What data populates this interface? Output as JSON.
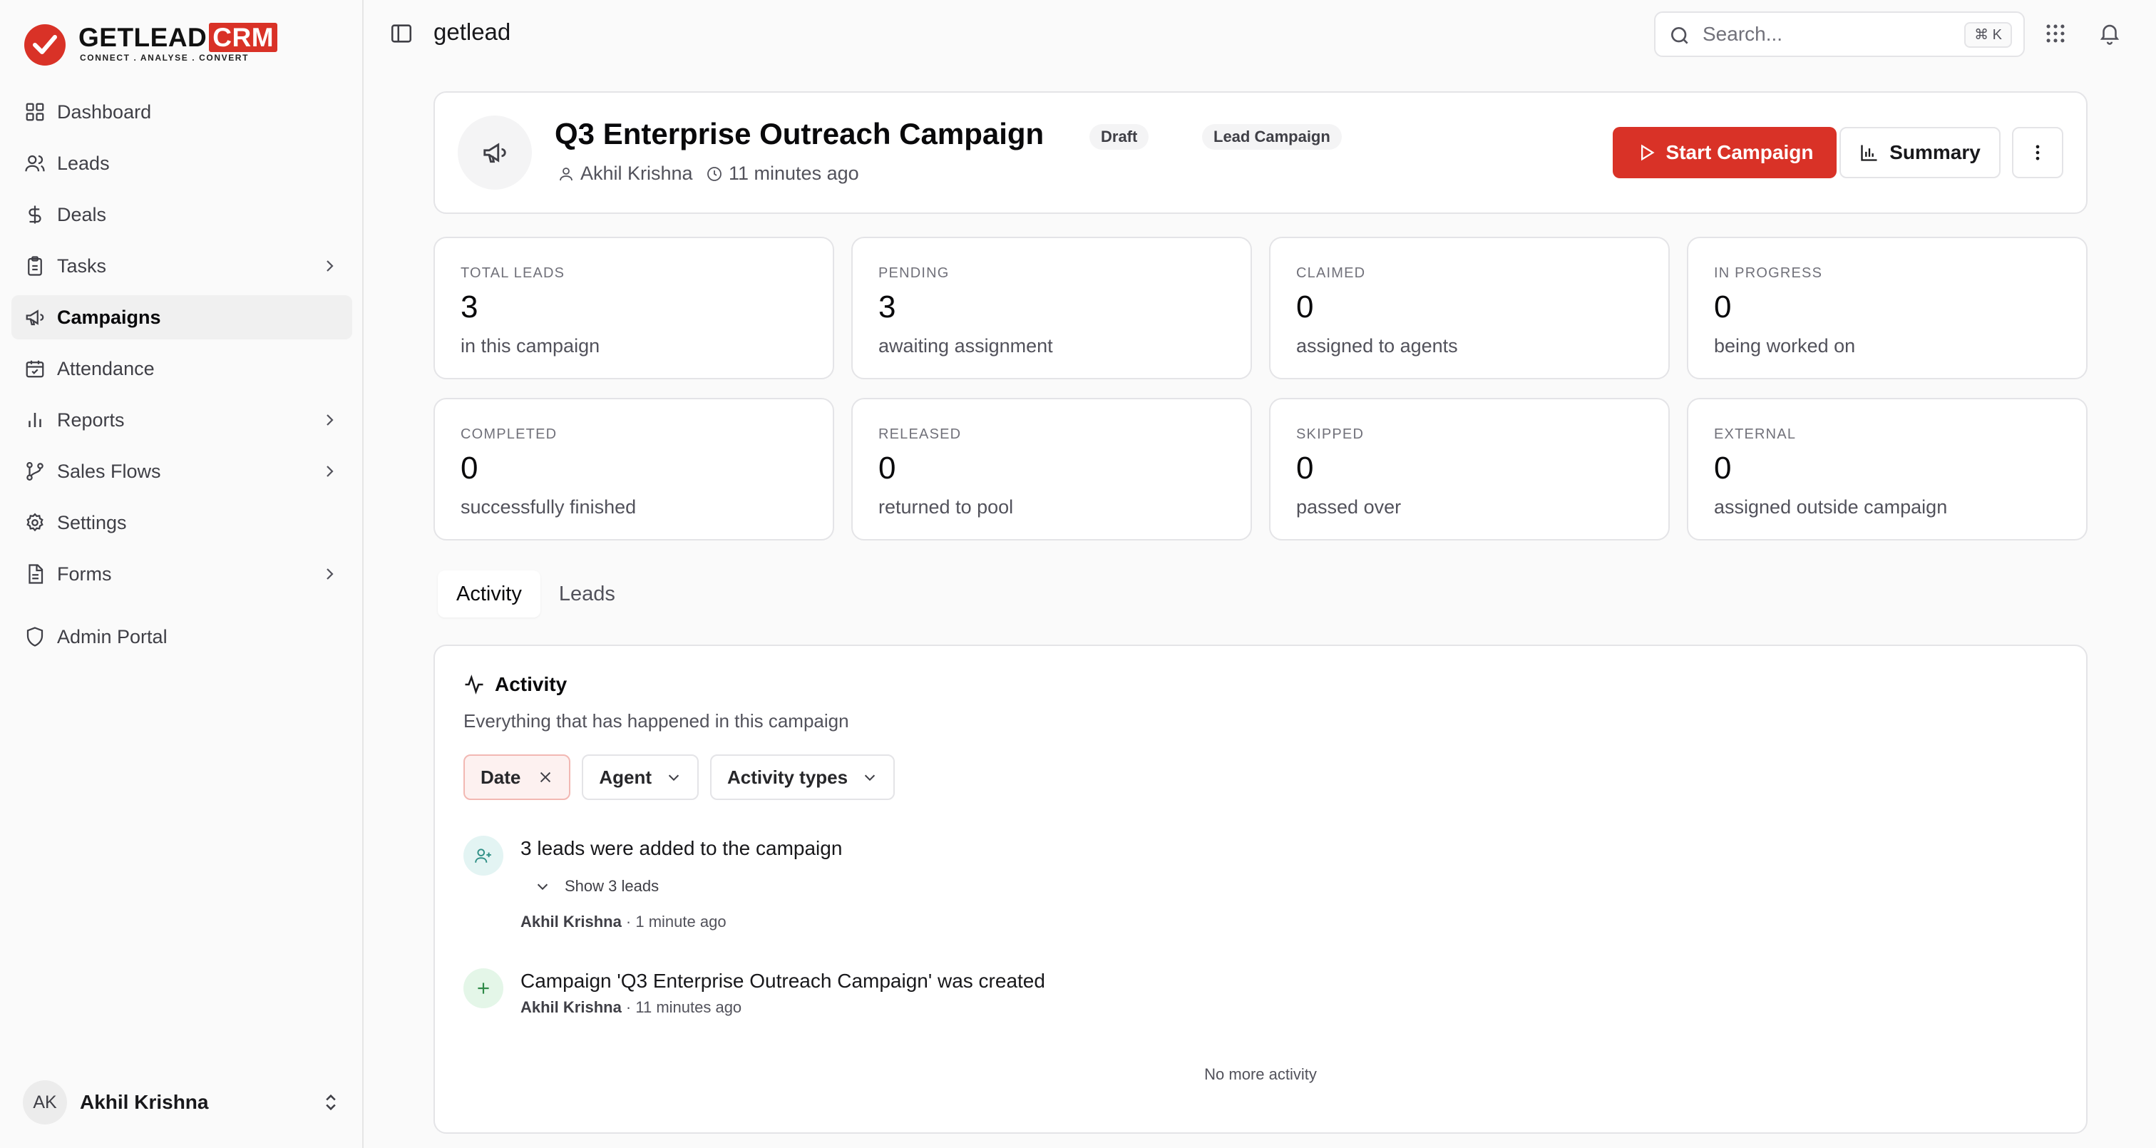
{
  "brand": {
    "name": "GETLEAD",
    "suffix": "CRM",
    "tagline": "CONNECT  .  ANALYSE  .  CONVERT",
    "accent": "#d93227"
  },
  "sidebar": {
    "items": [
      {
        "label": "Dashboard",
        "icon": "dashboard-icon"
      },
      {
        "label": "Leads",
        "icon": "users-icon"
      },
      {
        "label": "Deals",
        "icon": "dollar-icon"
      },
      {
        "label": "Tasks",
        "icon": "clipboard-icon",
        "expandable": true
      },
      {
        "label": "Campaigns",
        "icon": "megaphone-icon",
        "active": true
      },
      {
        "label": "Attendance",
        "icon": "calendar-check-icon"
      },
      {
        "label": "Reports",
        "icon": "bar-chart-icon",
        "expandable": true
      },
      {
        "label": "Sales Flows",
        "icon": "git-branch-icon",
        "expandable": true
      },
      {
        "label": "Settings",
        "icon": "gear-icon"
      },
      {
        "label": "Forms",
        "icon": "file-icon",
        "expandable": true
      }
    ],
    "admin": {
      "label": "Admin Portal",
      "icon": "shield-icon"
    },
    "user": {
      "initials": "AK",
      "name": "Akhil Krishna"
    }
  },
  "topbar": {
    "workspace": "getlead",
    "search_placeholder": "Search...",
    "search_shortcut": "⌘ K"
  },
  "campaign": {
    "title": "Q3 Enterprise Outreach Campaign",
    "badges": [
      "Draft",
      "Lead Campaign"
    ],
    "owner": "Akhil Krishna",
    "updated": "11 minutes ago",
    "actions": {
      "start": "Start Campaign",
      "summary": "Summary"
    }
  },
  "stats": [
    {
      "label": "TOTAL LEADS",
      "value": "3",
      "desc": "in this campaign"
    },
    {
      "label": "PENDING",
      "value": "3",
      "desc": "awaiting assignment"
    },
    {
      "label": "CLAIMED",
      "value": "0",
      "desc": "assigned to agents"
    },
    {
      "label": "IN PROGRESS",
      "value": "0",
      "desc": "being worked on"
    },
    {
      "label": "COMPLETED",
      "value": "0",
      "desc": "successfully finished"
    },
    {
      "label": "RELEASED",
      "value": "0",
      "desc": "returned to pool"
    },
    {
      "label": "SKIPPED",
      "value": "0",
      "desc": "passed over"
    },
    {
      "label": "EXTERNAL",
      "value": "0",
      "desc": "assigned outside campaign"
    }
  ],
  "tabs": [
    {
      "label": "Activity",
      "active": true
    },
    {
      "label": "Leads",
      "active": false
    }
  ],
  "activity": {
    "title": "Activity",
    "subtitle": "Everything that has happened in this campaign",
    "filters": {
      "date": "Date",
      "agent": "Agent",
      "types": "Activity types"
    },
    "events": [
      {
        "title": "3 leads were added to the campaign",
        "expand": "Show 3 leads",
        "actor": "Akhil Krishna",
        "time": " · 1 minute ago",
        "icon": "user-plus-icon",
        "color": "#e3f4f3"
      },
      {
        "title": "Campaign 'Q3 Enterprise Outreach Campaign' was created",
        "actor": "Akhil Krishna",
        "time": " · 11 minutes ago",
        "icon": "plus-icon",
        "color": "#e4f6e8"
      }
    ],
    "end_text": "No more activity"
  }
}
